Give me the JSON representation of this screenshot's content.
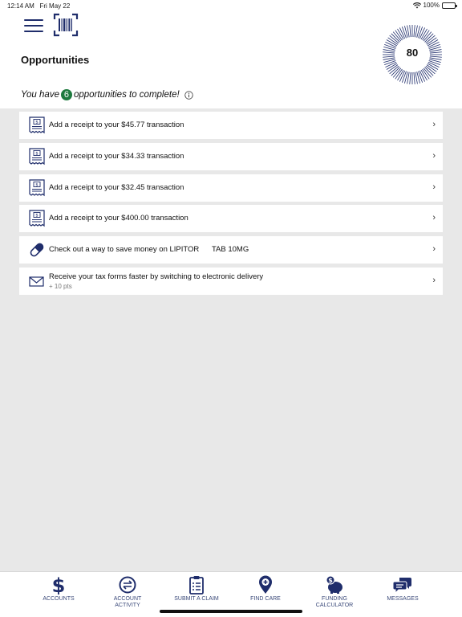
{
  "status_bar": {
    "time": "12:14 AM",
    "date": "Fri May 22",
    "battery": "100%"
  },
  "header": {
    "title": "Opportunities",
    "score": "80"
  },
  "summary": {
    "prefix": "You have",
    "count": "6",
    "suffix": "opportunities to complete!"
  },
  "opportunities": [
    {
      "icon": "receipt-icon",
      "text": "Add a receipt to your $45.77 transaction"
    },
    {
      "icon": "receipt-icon",
      "text": "Add a receipt to your $34.33 transaction"
    },
    {
      "icon": "receipt-icon",
      "text": "Add a receipt to your $32.45 transaction"
    },
    {
      "icon": "receipt-icon",
      "text": "Add a receipt to your $400.00 transaction"
    },
    {
      "icon": "pill-icon",
      "text": "Check out a way to save money on LIPITOR      TAB 10MG"
    },
    {
      "icon": "envelope-icon",
      "text": "Receive your tax forms faster by switching to electronic delivery",
      "sub": "+ 10 pts"
    }
  ],
  "tabs": [
    {
      "label": "ACCOUNTS",
      "icon": "dollar-icon"
    },
    {
      "label": "ACCOUNT\nACTIVITY",
      "icon": "transfer-icon"
    },
    {
      "label": "SUBMIT A CLAIM",
      "icon": "clipboard-icon"
    },
    {
      "label": "FIND CARE",
      "icon": "map-pin-icon"
    },
    {
      "label": "FUNDING\nCALCULATOR",
      "icon": "piggy-bank-icon"
    },
    {
      "label": "MESSAGES",
      "icon": "chat-icon"
    }
  ],
  "colors": {
    "brand_navy": "#1f2d6b",
    "badge_green": "#1d7a3e",
    "background": "#e8e8e8"
  }
}
